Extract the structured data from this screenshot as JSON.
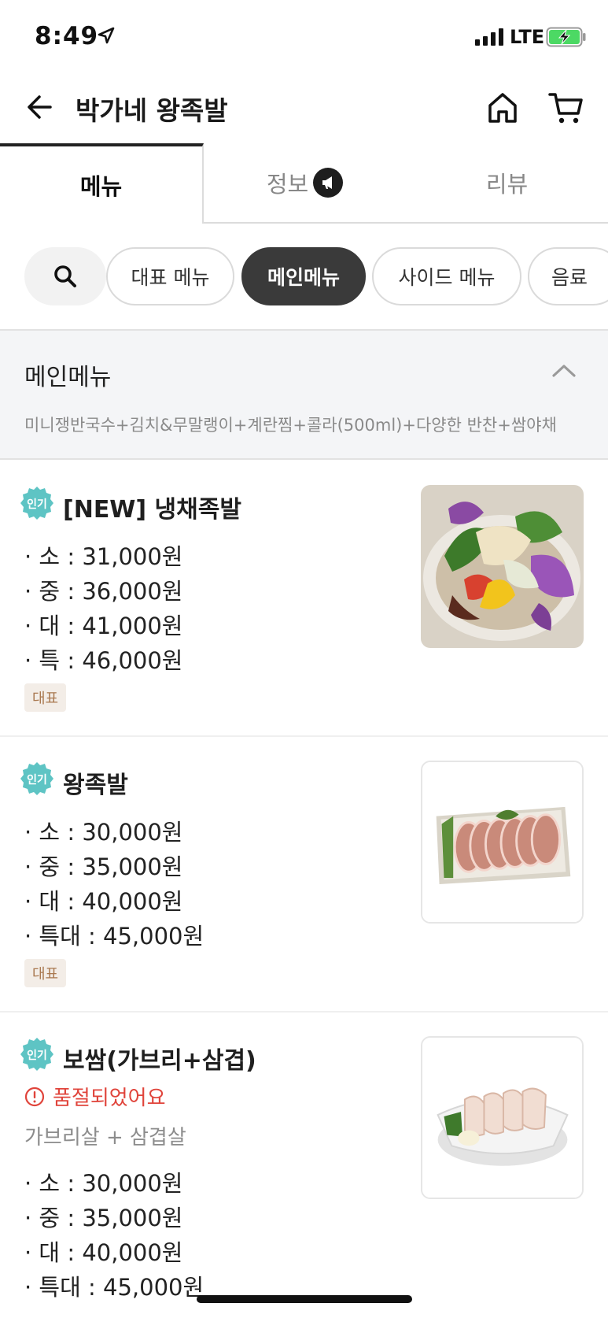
{
  "status_bar": {
    "time": "8:49",
    "network": "LTE"
  },
  "header": {
    "title": "박가네 왕족발"
  },
  "tabs": [
    {
      "label": "메뉴"
    },
    {
      "label": "정보"
    },
    {
      "label": "리뷰"
    }
  ],
  "chips": [
    {
      "label": "대표 메뉴"
    },
    {
      "label": "메인메뉴"
    },
    {
      "label": "사이드 메뉴"
    },
    {
      "label": "음료"
    }
  ],
  "section": {
    "title": "메인메뉴",
    "description": "미니쟁반국수+김치&무말랭이+계란찜+콜라(500ml)+다양한 반찬+쌈야채"
  },
  "popular_badge": "인기",
  "items": [
    {
      "name": "[NEW] 냉채족발",
      "prices": [
        "· 소 : 31,000원",
        "· 중 : 36,000원",
        "· 대 : 41,000원",
        "· 특 : 46,000원"
      ],
      "tag": "대표",
      "image": "cold-jokbal-salad"
    },
    {
      "name": "왕족발",
      "prices": [
        "· 소 : 30,000원",
        "· 중 : 35,000원",
        "· 대 : 40,000원",
        "· 특대 : 45,000원"
      ],
      "tag": "대표",
      "image": "jokbal-platter"
    },
    {
      "name": "보쌈(가브리+삼겹)",
      "soldout": "품절되었어요",
      "subtitle": "가브리살 + 삼겹살",
      "prices": [
        "· 소 : 30,000원",
        "· 중 : 35,000원",
        "· 대 : 40,000원",
        "· 특대 : 45,000원"
      ],
      "image": "bossam-plate"
    }
  ],
  "colors": {
    "accent_dark": "#3a3a3a",
    "popular_badge": "#5ec4c4",
    "soldout": "#e0443b",
    "tag_bg": "#f3ede7",
    "tag_text": "#a9784f"
  }
}
